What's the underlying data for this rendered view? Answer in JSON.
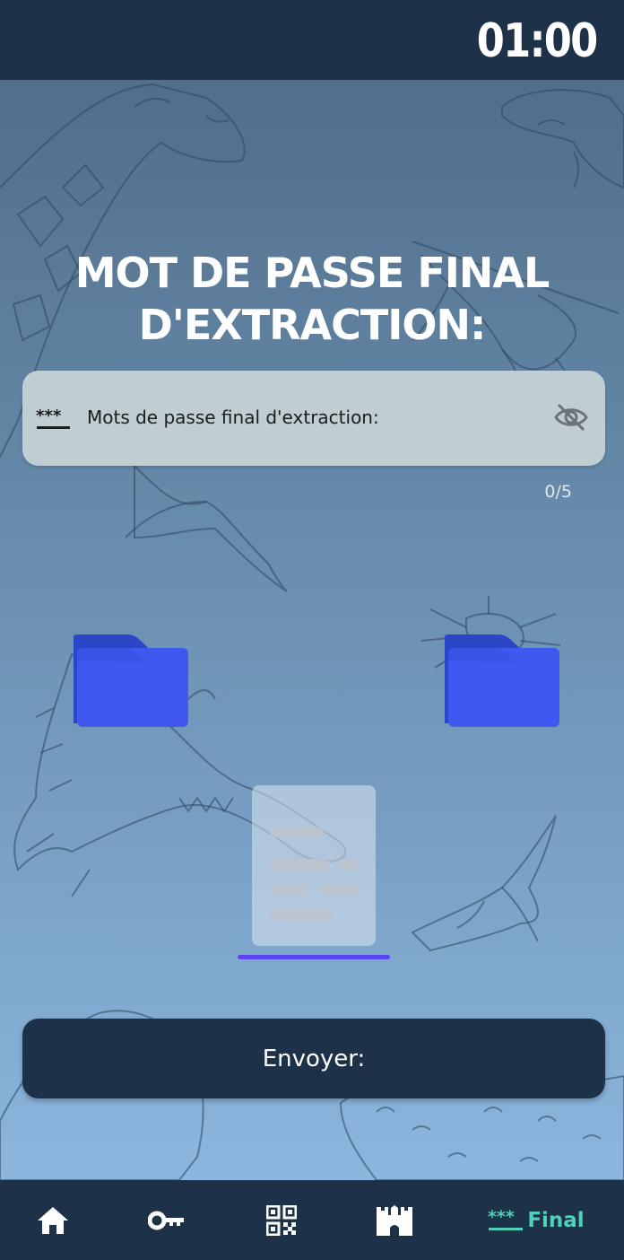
{
  "header": {
    "timer": "01:00"
  },
  "main": {
    "title_line1": "MOT DE PASSE FINAL",
    "title_line2": "D'EXTRACTION:",
    "password_field": {
      "label": "Mots de passe final d'extraction:",
      "icon": "password-stars-icon",
      "toggle_icon": "eye-off-icon"
    },
    "counter": "0/5",
    "folders": [
      {
        "icon": "folder-icon",
        "color": "#3d5af1"
      },
      {
        "icon": "folder-icon",
        "color": "#3d5af1"
      }
    ],
    "document": {
      "icon": "document-icon"
    },
    "accent_color": "#5b45f2",
    "send_button": "Envoyer:"
  },
  "nav": {
    "items": [
      {
        "icon": "home-icon"
      },
      {
        "icon": "key-icon"
      },
      {
        "icon": "qr-code-icon"
      },
      {
        "icon": "castle-icon"
      },
      {
        "icon": "password-stars-icon",
        "label": "Final",
        "active": true
      }
    ],
    "active_color": "#4fd1b8"
  }
}
